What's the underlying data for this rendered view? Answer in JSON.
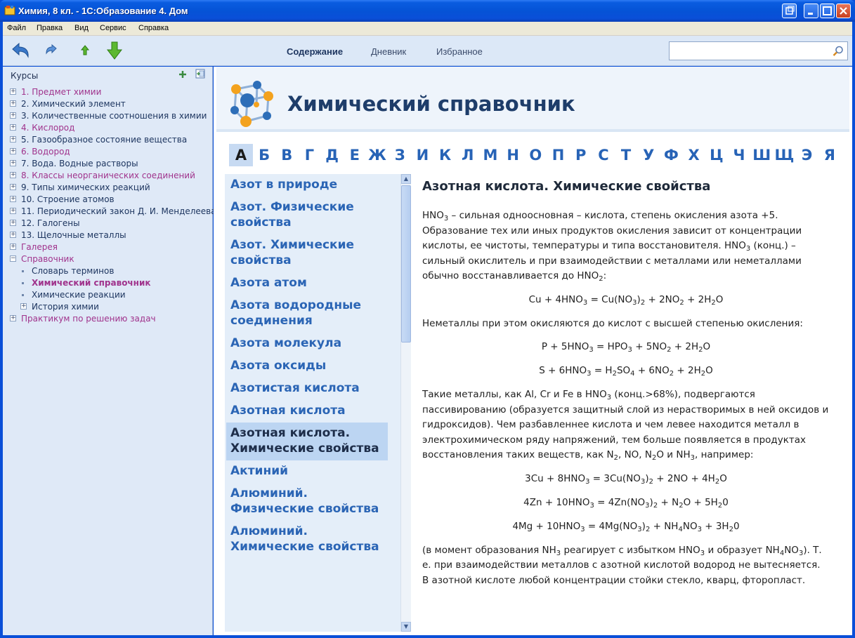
{
  "window": {
    "title": "Химия, 8 кл. - 1С:Образование 4. Дом",
    "minimize": "_",
    "maximize": "□",
    "close": "✕"
  },
  "menu": [
    "Файл",
    "Правка",
    "Вид",
    "Сервис",
    "Справка"
  ],
  "toolbar": {
    "tabs": [
      "Содержание",
      "Дневник",
      "Избранное"
    ],
    "active_tab": "Содержание",
    "search_value": ""
  },
  "sidebar": {
    "header": "Курсы",
    "items": [
      {
        "label": "1. Предмет химии",
        "color": "#a0338c",
        "expander": "+"
      },
      {
        "label": "2. Химический элемент",
        "color": "#1e3660",
        "expander": "+"
      },
      {
        "label": "3. Количественные соотношения в химии",
        "color": "#1e3660",
        "expander": "+"
      },
      {
        "label": "4. Кислород",
        "color": "#a0338c",
        "expander": "+"
      },
      {
        "label": "5. Газообразное состояние вещества",
        "color": "#1e3660",
        "expander": "+"
      },
      {
        "label": "6. Водород",
        "color": "#a0338c",
        "expander": "+"
      },
      {
        "label": "7. Вода. Водные растворы",
        "color": "#1e3660",
        "expander": "+"
      },
      {
        "label": "8. Классы неорганических соединений",
        "color": "#a0338c",
        "expander": "+"
      },
      {
        "label": "9. Типы химических реакций",
        "color": "#1e3660",
        "expander": "+"
      },
      {
        "label": "10. Строение атомов",
        "color": "#1e3660",
        "expander": "+"
      },
      {
        "label": "11. Периодический закон Д. И. Менделеева",
        "color": "#1e3660",
        "expander": "+"
      },
      {
        "label": "12. Галогены",
        "color": "#1e3660",
        "expander": "+"
      },
      {
        "label": "13. Щелочные металлы",
        "color": "#1e3660",
        "expander": "+"
      },
      {
        "label": "Галерея",
        "color": "#a0338c",
        "expander": "+"
      },
      {
        "label": "Справочник",
        "color": "#a0338c",
        "expander": "−"
      },
      {
        "label": "Словарь терминов",
        "color": "#1e3660",
        "child": true,
        "bullet": true
      },
      {
        "label": "Химический справочник",
        "color": "#a0338c",
        "child": true,
        "bullet": true,
        "bold": true
      },
      {
        "label": "Химические реакции",
        "color": "#1e3660",
        "child": true,
        "bullet": true
      },
      {
        "label": "История химии",
        "color": "#1e3660",
        "child": true,
        "expander": "+"
      },
      {
        "label": "Практикум по решению задач",
        "color": "#a0338c",
        "expander": "+"
      }
    ]
  },
  "banner": {
    "title": "Химический справочник"
  },
  "alphabet": {
    "letters": [
      "А",
      "Б",
      "В",
      "Г",
      "Д",
      "Е",
      "Ж",
      "З",
      "И",
      "К",
      "Л",
      "М",
      "Н",
      "О",
      "П",
      "Р",
      "С",
      "Т",
      "У",
      "Ф",
      "Х",
      "Ц",
      "Ч",
      "Ш",
      "Щ",
      "Э",
      "Я"
    ],
    "active": "А"
  },
  "article_list": [
    {
      "label": "Азот в природе"
    },
    {
      "label": "Азот. Физические свойства"
    },
    {
      "label": "Азот. Химические свойства"
    },
    {
      "label": "Азота атом"
    },
    {
      "label": "Азота водородные соединения"
    },
    {
      "label": "Азота молекула"
    },
    {
      "label": "Азота оксиды"
    },
    {
      "label": "Азотистая кислота"
    },
    {
      "label": "Азотная кислота"
    },
    {
      "label": "Азотная кислота. Химические свойства",
      "active": true
    },
    {
      "label": "Актиний"
    },
    {
      "label": "Алюминий. Физические свойства"
    },
    {
      "label": "Алюминий. Химические свойства"
    }
  ],
  "article": {
    "title": "Азотная кислота. Химические свойства",
    "blocks": [
      {
        "type": "p",
        "html": "HNO<sub>3</sub> – сильная одноосновная – кислота, степень окисления азота +5. Образование тех или иных продуктов окисления зависит от концентрации кислоты, ее чистоты, температуры и типа восстановителя. HNO<sub>3</sub> (конц.) – сильный окислитель и при взаимодействии с металлами или неметаллами обычно восстанавливается до HNO<sub>2</sub>:"
      },
      {
        "type": "eq",
        "html": "Cu + 4HNO<sub>3</sub> = Cu(NO<sub>3</sub>)<sub>2</sub> + 2NO<sub>2</sub> + 2H<sub>2</sub>O"
      },
      {
        "type": "p",
        "html": "Неметаллы при этом окисляются до кислот с высшей степенью окисления:"
      },
      {
        "type": "eq",
        "html": "P + 5HNO<sub>3</sub> = HPO<sub>3</sub> + 5NO<sub>2</sub> + 2H<sub>2</sub>O"
      },
      {
        "type": "eq",
        "html": "S + 6HNO<sub>3</sub> = H<sub>2</sub>SO<sub>4</sub> + 6NO<sub>2</sub> + 2H<sub>2</sub>O"
      },
      {
        "type": "p",
        "html": "Такие металлы, как Al, Cr и Fe в HNO<sub>3</sub> (конц.&gt;68%), подвергаются пассивированию (образуется защитный слой из нерастворимых в ней оксидов и гидроксидов). Чем разбавленнее кислота и чем левее находится металл в электрохимическом ряду напряжений, тем больше появляется в продуктах восстановления таких веществ, как N<sub>2</sub>, NO, N<sub>2</sub>O и NH<sub>3</sub>, например:"
      },
      {
        "type": "eq",
        "html": "3Cu + 8HNO<sub>3</sub> = 3Cu(NO<sub>3</sub>)<sub>2</sub> + 2NO + 4H<sub>2</sub>O"
      },
      {
        "type": "eq",
        "html": "4Zn + 10HNO<sub>3</sub> = 4Zn(NO<sub>3</sub>)<sub>2</sub> + N<sub>2</sub>O + 5H<sub>2</sub>0"
      },
      {
        "type": "eq",
        "html": "4Mg + 10HNO<sub>3</sub> = 4Mg(NO<sub>3</sub>)<sub>2</sub> + NH<sub>4</sub>NO<sub>3</sub> + 3H<sub>2</sub>0"
      },
      {
        "type": "p",
        "html": "(в момент образования NH<sub>3</sub> реагирует с избытком HNO<sub>3</sub> и образует NH<sub>4</sub>NO<sub>3</sub>). Т. е. при взаимодействии металлов с азотной кислотой водород не вытесняется. В азотной кислоте любой концентрации стойки стекло, кварц, фторопласт."
      }
    ]
  }
}
